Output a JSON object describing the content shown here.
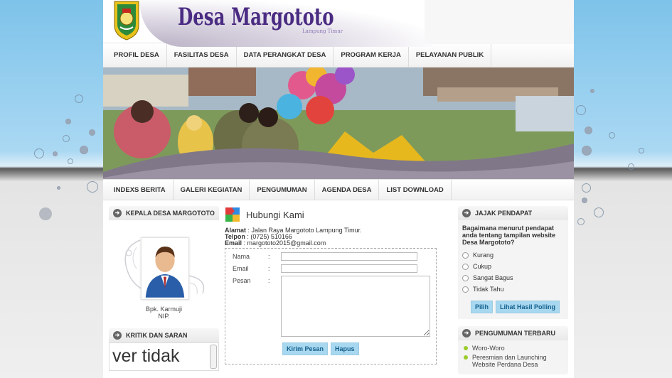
{
  "header": {
    "site_title": "Desa Margototo",
    "subtitle": "Lampung Timur"
  },
  "nav_top": [
    {
      "label": "PROFIL DESA"
    },
    {
      "label": "FASILITAS DESA"
    },
    {
      "label": "DATA PERANGKAT DESA"
    },
    {
      "label": "PROGRAM KERJA"
    },
    {
      "label": "PELAYANAN PUBLIK"
    }
  ],
  "nav_bottom": [
    {
      "label": "INDEXS BERITA"
    },
    {
      "label": "GALERI KEGIATAN"
    },
    {
      "label": "PENGUMUMAN"
    },
    {
      "label": "AGENDA DESA"
    },
    {
      "label": "LIST DOWNLOAD"
    }
  ],
  "kepala": {
    "title": "KEPALA DESA MARGOTOTO",
    "name": "Bpk. Karmuji",
    "nip": "NIP."
  },
  "kritik": {
    "title": "KRITIK DAN SARAN",
    "scroll_text": "ver tidak"
  },
  "kontak": {
    "title": "Hubungi Kami",
    "alamat_label": "Alamat",
    "alamat": ": Jalan Raya Margototo Lampung Timur.",
    "telpon_label": "Telpon",
    "telpon": ": (0725) 510166",
    "email_label": "Email",
    "email": ": margototo2015@gmail.com",
    "field_nama": "Nama",
    "field_email": "Email",
    "field_pesan": "Pesan",
    "colon": ":",
    "send_label": "Kirim Pesan",
    "delete_label": "Hapus"
  },
  "jajak": {
    "title": "JAJAK PENDAPAT",
    "question": "Bagaimana menurut pendapat anda tentang tampilan website Desa Margototo?",
    "options": [
      "Kurang",
      "Cukup",
      "Sangat Bagus",
      "Tidak Tahu"
    ],
    "vote_label": "Pilih",
    "results_label": "Lihat Hasil Polling"
  },
  "pengumuman": {
    "title": "PENGUMUMAN TERBARU",
    "items": [
      "Woro-Woro",
      "Peresmian dan Launching Website Perdana Desa"
    ]
  },
  "colors": {
    "title_purple": "#4a2b82",
    "button_blue": "#a8d8f0",
    "bullet_green": "#9ccc2b"
  }
}
